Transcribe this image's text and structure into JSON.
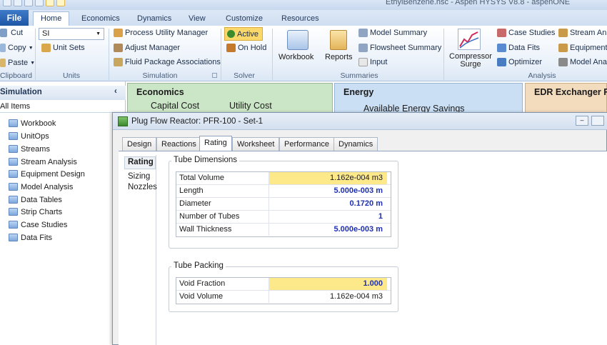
{
  "window": {
    "title": "EthylBenzene.hsc - Aspen HYSYS V8.8 - aspenONE"
  },
  "ribbon": {
    "file_tab": "File",
    "tabs": [
      "Home",
      "Economics",
      "Dynamics",
      "View",
      "Customize",
      "Resources"
    ],
    "clipboard": {
      "cut": "Cut",
      "copy": "Copy",
      "paste": "Paste",
      "label": "Clipboard"
    },
    "units": {
      "unit_set_value": "SI",
      "unit_sets": "Unit Sets",
      "label": "Units"
    },
    "simulation": {
      "process_utility": "Process Utility Manager",
      "adjust": "Adjust Manager",
      "fluid_pkg": "Fluid Package Associations",
      "label": "Simulation"
    },
    "solver": {
      "active": "Active",
      "on_hold": "On Hold",
      "label": "Solver"
    },
    "summaries": {
      "workbook": "Workbook",
      "reports": "Reports",
      "model_summary": "Model Summary",
      "flowsheet_summary": "Flowsheet Summary",
      "input": "Input",
      "label": "Summaries"
    },
    "compressor": {
      "label1": "Compressor",
      "label2": "Surge"
    },
    "analysis": {
      "case_studies": "Case Studies",
      "data_fits": "Data Fits",
      "optimizer": "Optimizer",
      "stream_analysis": "Stream Ana",
      "equipment": "Equipment",
      "model_analysis": "Model Anal",
      "label": "Analysis"
    }
  },
  "navigator": {
    "title": "Simulation",
    "filter": "All Items",
    "items": [
      "Workbook",
      "UnitOps",
      "Streams",
      "Stream Analysis",
      "Equipment Design",
      "Model Analysis",
      "Data Tables",
      "Strip Charts",
      "Case Studies",
      "Data Fits"
    ]
  },
  "panels": {
    "economics": {
      "title": "Economics",
      "capital": "Capital Cost",
      "utility": "Utility Cost"
    },
    "energy": {
      "title": "Energy",
      "savings": "Available Energy Savings"
    },
    "edr": {
      "title": "EDR Exchanger F"
    }
  },
  "dialog": {
    "title": "Plug Flow Reactor: PFR-100 - Set-1",
    "tabs": [
      "Design",
      "Reactions",
      "Rating",
      "Worksheet",
      "Performance",
      "Dynamics"
    ],
    "active_tab": "Rating",
    "subnav": [
      "Rating",
      "Sizing",
      "Nozzles"
    ],
    "tube_dimensions": {
      "legend": "Tube Dimensions",
      "rows": [
        {
          "label": "Total Volume",
          "value": "1.162e-004 m3"
        },
        {
          "label": "Length",
          "value": "5.000e-003 m"
        },
        {
          "label": "Diameter",
          "value": "0.1720 m"
        },
        {
          "label": "Number of Tubes",
          "value": "1"
        },
        {
          "label": "Wall Thickness",
          "value": "5.000e-003 m"
        }
      ]
    },
    "tube_packing": {
      "legend": "Tube Packing",
      "rows": [
        {
          "label": "Void Fraction",
          "value": "1.000"
        },
        {
          "label": "Void Volume",
          "value": "1.162e-004 m3"
        }
      ]
    }
  },
  "colors": {
    "accent": "#1f57a5",
    "specified": "#1e2fb4",
    "highlight": "#fde88a",
    "econ_panel": "#c9e4c5",
    "energy_panel": "#c8ddf3",
    "edr_panel": "#f3d9b8"
  }
}
